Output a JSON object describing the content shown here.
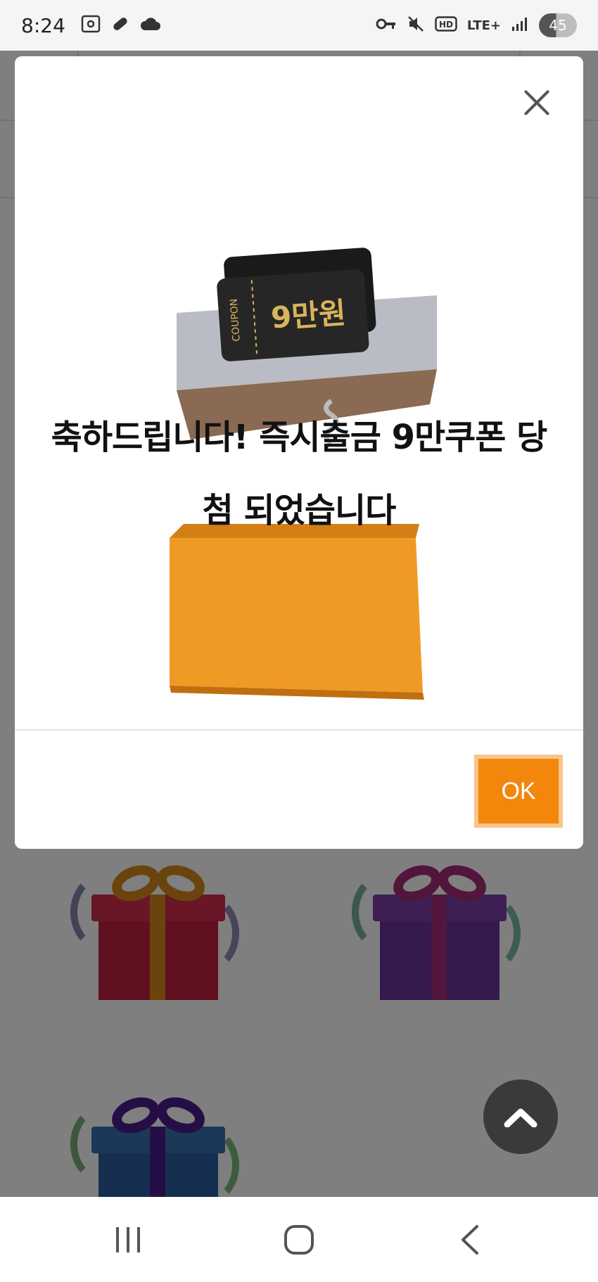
{
  "status_bar": {
    "time": "8:24",
    "left_icons": [
      "screenshot-icon",
      "pill-icon",
      "cloud-icon"
    ],
    "right_icons": [
      "key-icon",
      "mute-icon",
      "hd-icon",
      "signal-icon"
    ],
    "network": "LTE+",
    "battery": "45"
  },
  "modal": {
    "message_line1": "축하드립니다! 즉시출금 9만쿠폰 당",
    "message_line2": "첨 되었습니다",
    "coupon_label": "COUPON",
    "coupon_amount": "9만원",
    "ok_label": "OK",
    "accent_color": "#f2870b"
  },
  "background_gifts": [
    {
      "name": "red-gift",
      "box_color": "#c0213f",
      "ribbon_color": "#d6891a"
    },
    {
      "name": "purple-gift",
      "box_color": "#7a3fa8",
      "ribbon_color": "#a42c7a"
    },
    {
      "name": "blue-gift",
      "box_color": "#2c5fa0",
      "ribbon_color": "#4b1c8c"
    }
  ],
  "nav_bar": {
    "buttons": [
      "recent-apps",
      "home",
      "back"
    ]
  }
}
